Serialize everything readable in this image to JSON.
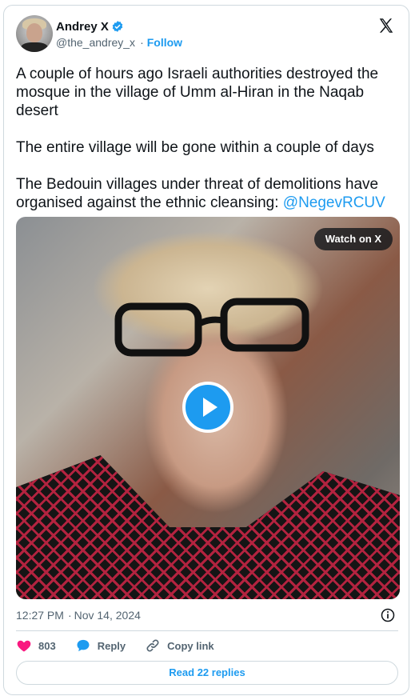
{
  "author": {
    "display_name": "Andrey X",
    "handle": "@the_andrey_x",
    "follow_label": "Follow"
  },
  "tweet": {
    "paragraphs": [
      "A couple of hours ago Israeli authorities destroyed the mosque in the village of Umm al-Hiran in the Naqab desert",
      "The entire village will be gone within a couple of days"
    ],
    "last_paragraph_text": "The Bedouin villages under threat of demolitions have organised against the ethnic cleansing: ",
    "mention": "@NegevRCUV"
  },
  "media": {
    "watch_label": "Watch on X"
  },
  "meta": {
    "time": "12:27 PM",
    "separator": "·",
    "date": "Nov 14, 2024"
  },
  "actions": {
    "like_count": "803",
    "reply_label": "Reply",
    "copy_label": "Copy link"
  },
  "footer": {
    "read_replies_label": "Read 22 replies"
  },
  "colors": {
    "accent": "#1d9bf0",
    "like": "#f91880",
    "text_secondary": "#536471",
    "border": "#cfd9de"
  },
  "icons": {
    "verified": "verified-badge-icon",
    "logo": "x-logo-icon",
    "play": "play-icon",
    "info": "info-icon",
    "like": "heart-icon",
    "reply": "speech-bubble-icon",
    "copy": "link-icon"
  }
}
